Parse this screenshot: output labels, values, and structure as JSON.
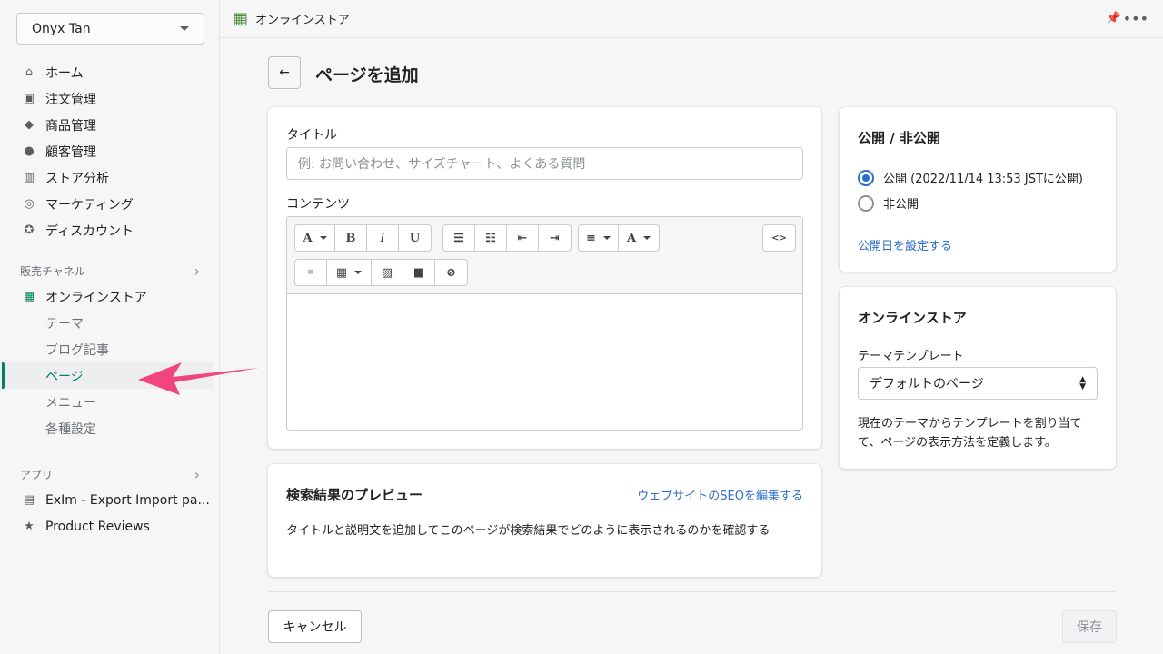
{
  "sidebar": {
    "store": "Onyx Tan",
    "items": [
      {
        "label": "ホーム",
        "icon": "home-icon"
      },
      {
        "label": "注文管理",
        "icon": "inbox-icon"
      },
      {
        "label": "商品管理",
        "icon": "tag-icon"
      },
      {
        "label": "顧客管理",
        "icon": "person-icon"
      },
      {
        "label": "ストア分析",
        "icon": "bar-chart-icon"
      },
      {
        "label": "マーケティング",
        "icon": "target-icon"
      },
      {
        "label": "ディスカウント",
        "icon": "discount-icon"
      }
    ],
    "sales_channels": "販売チャネル",
    "online_store": "オンラインストア",
    "subitems": [
      "テーマ",
      "ブログ記事",
      "ページ",
      "メニュー",
      "各種設定"
    ],
    "apps": "アプリ",
    "app_items": [
      "ExIm - Export Import pa...",
      "Product Reviews"
    ]
  },
  "topbar": {
    "title": "オンラインストア"
  },
  "page": {
    "title": "ページを追加"
  },
  "form": {
    "title_label": "タイトル",
    "title_placeholder": "例: お問い合わせ、サイズチャート、よくある質問",
    "content_label": "コンテンツ",
    "toolbar": {
      "font": "A",
      "bold": "B",
      "italic": "I",
      "underline": "U",
      "html": "<>"
    }
  },
  "seo": {
    "title": "検索結果のプレビュー",
    "edit_link": "ウェブサイトのSEOを編集する",
    "desc": "タイトルと説明文を追加してこのページが検索結果でどのように表示されるのかを確認する"
  },
  "visibility": {
    "title": "公開 / 非公開",
    "options": [
      "公開 (2022/11/14 13:53 JSTに公開)",
      "非公開"
    ],
    "selected": 0,
    "set_date": "公開日を設定する"
  },
  "online_store_card": {
    "title": "オンラインストア",
    "template_label": "テーマテンプレート",
    "template_value": "デフォルトのページ",
    "help": "現在のテーマからテンプレートを割り当てて、ページの表示方法を定義します。"
  },
  "footer": {
    "cancel": "キャンセル",
    "save": "保存"
  },
  "colors": {
    "accent": "#008060",
    "link": "#2c6ecb",
    "annotation_arrow": "#f0457d",
    "pin": "#e59700"
  }
}
